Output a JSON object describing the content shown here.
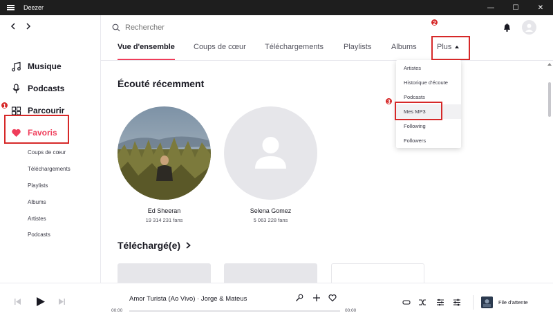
{
  "window": {
    "title": "Deezer"
  },
  "search": {
    "placeholder": "Rechercher"
  },
  "sidebar": {
    "main": [
      {
        "label": "Musique",
        "icon": "music-note-icon"
      },
      {
        "label": "Podcasts",
        "icon": "microphone-icon"
      },
      {
        "label": "Parcourir",
        "icon": "grid-icon"
      },
      {
        "label": "Favoris",
        "icon": "heart-icon"
      }
    ],
    "sub": [
      "Coups de cœur",
      "Téléchargements",
      "Playlists",
      "Albums",
      "Artistes",
      "Podcasts"
    ]
  },
  "tabs": [
    "Vue d'ensemble",
    "Coups de cœur",
    "Téléchargements",
    "Playlists",
    "Albums",
    "Plus"
  ],
  "dropdown": [
    "Artistes",
    "Historique d'écoute",
    "Podcasts",
    "Mes MP3",
    "Following",
    "Followers"
  ],
  "sections": {
    "recent": "Écouté récemment",
    "downloaded": "Téléchargé(e)"
  },
  "artists": [
    {
      "name": "Ed Sheeran",
      "fans": "19 314 231 fans"
    },
    {
      "name": "Selena Gomez",
      "fans": "5 063 228 fans"
    }
  ],
  "annotations": [
    "1",
    "2",
    "3"
  ],
  "player": {
    "track": "Amor Turista (Ao Vivo) · Jorge & Mateus",
    "time_start": "00:00",
    "time_end": "00:00",
    "queue": "File d'attente"
  },
  "colors": {
    "accent": "#ef3d5a",
    "annotation": "#d62828"
  }
}
